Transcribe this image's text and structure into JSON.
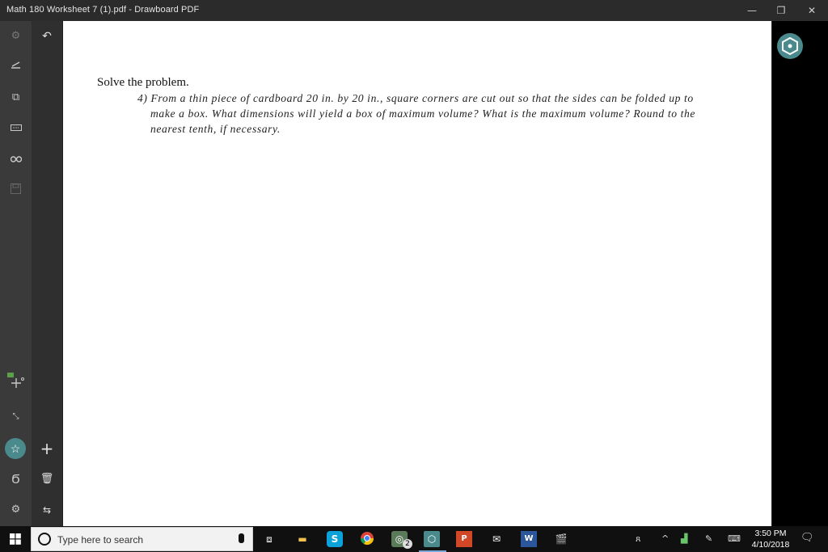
{
  "window": {
    "title": "Math 180 Worksheet 7 (1).pdf - Drawboard PDF",
    "minimize": "—",
    "restore": "❐",
    "close": "✕"
  },
  "toolbar_left": {
    "icons": [
      "settings-icon",
      "pen-icon",
      "copy-icon",
      "keyboard-icon",
      "binoculars-icon",
      "save-icon",
      "ruler-add-icon",
      "expand-icon",
      "favorite-star-icon",
      "undo-ink-icon",
      "gear-icon"
    ]
  },
  "toolbar_left2": {
    "icons": [
      "undo-icon",
      "add-icon",
      "trash-icon",
      "swap-icon"
    ]
  },
  "document": {
    "heading": "Solve the problem.",
    "problem_number": "4)",
    "problem_text": "From a thin piece of cardboard 20 in. by 20 in., square corners are cut out so that the sides can be folded up to make a box. What dimensions will yield a box of maximum volume? What is the maximum volume? Round to the nearest tenth, if necessary."
  },
  "right_panel": {
    "icon": "drawboard-hex-icon"
  },
  "taskbar": {
    "search_placeholder": "Type here to search",
    "photos_badge": "2",
    "clock_time": "3:50 PM",
    "clock_date": "4/10/2018",
    "accent": "#4a8a8c"
  }
}
